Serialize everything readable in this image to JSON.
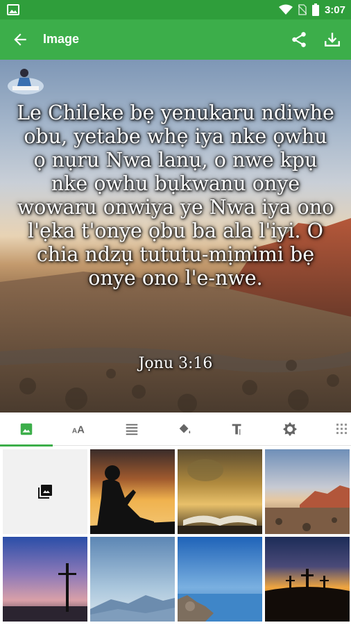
{
  "status_bar": {
    "time": "3:07",
    "icons": [
      "image-icon",
      "wifi-icon",
      "no-sim-icon",
      "battery-icon"
    ]
  },
  "app_bar": {
    "title": "Image",
    "back_icon": "arrow-back-icon",
    "share_icon": "share-icon",
    "download_icon": "download-icon"
  },
  "verse": {
    "text": "Le Chileke bẹ yenukaru ndiwhe obu, yetabe whẹ iya nke ọwhu ọ nụru Nwa lanụ, o nwe kpụ nke ọwhu bụkwanu onye wowaru onwiya ye Nwa iya ono l'ẹka t'onye ọbu ba ala l'iyi. O chia ndzụ tututu-mịmimi bẹ onye ono l'e-nwe.",
    "reference": "Jọnu 3:16"
  },
  "tabs": [
    {
      "name": "image-tab",
      "icon": "image-icon",
      "active": true
    },
    {
      "name": "font-tab",
      "icon": "font-size-icon",
      "active": false
    },
    {
      "name": "align-tab",
      "icon": "text-align-icon",
      "active": false
    },
    {
      "name": "color-tab",
      "icon": "paint-bucket-icon",
      "active": false
    },
    {
      "name": "text-style-tab",
      "icon": "text-format-icon",
      "active": false
    },
    {
      "name": "settings-tab",
      "icon": "brightness-icon",
      "active": false
    },
    {
      "name": "pattern-tab",
      "icon": "pattern-icon",
      "active": false
    }
  ],
  "colors": {
    "accent": "#3cae4a",
    "status_bar": "#2f9e3b"
  },
  "images": [
    {
      "name": "gallery-picker",
      "icon": "photo-library-icon"
    },
    {
      "name": "reading-silhouette-image"
    },
    {
      "name": "open-bible-image"
    },
    {
      "name": "desert-mountains-image"
    },
    {
      "name": "cross-sunset-image"
    },
    {
      "name": "blue-mountains-image"
    },
    {
      "name": "lake-rocks-image"
    },
    {
      "name": "three-crosses-image"
    }
  ]
}
